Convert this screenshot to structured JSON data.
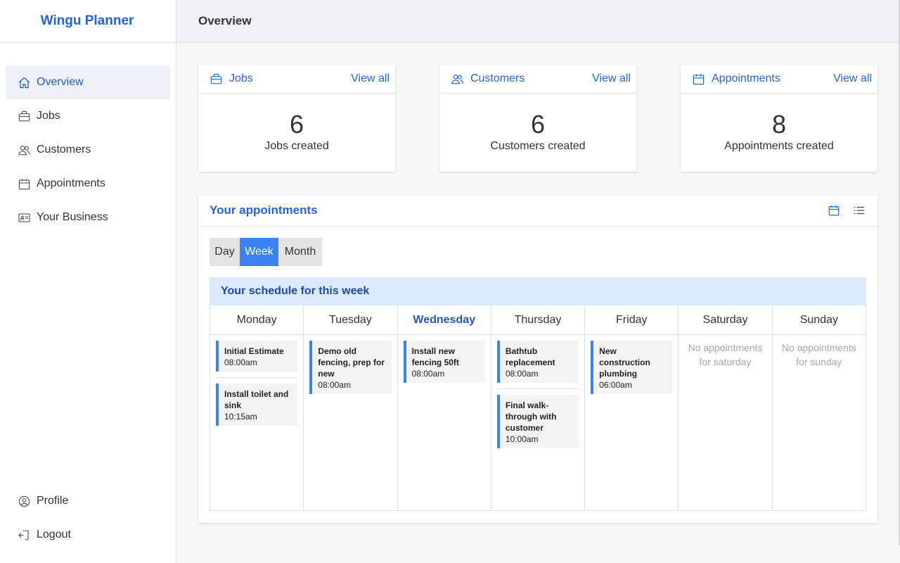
{
  "app": {
    "brand": "Wingu Planner",
    "page_title": "Overview"
  },
  "colors": {
    "accent": "#2563d9",
    "active_segment": "#3b82f6",
    "schedule_bar": "#dbeafe"
  },
  "sidebar": {
    "items": [
      {
        "label": "Overview",
        "icon": "home-icon",
        "active": true
      },
      {
        "label": "Jobs",
        "icon": "briefcase-icon"
      },
      {
        "label": "Customers",
        "icon": "users-icon"
      },
      {
        "label": "Appointments",
        "icon": "calendar-icon"
      },
      {
        "label": "Your Business",
        "icon": "id-card-icon"
      }
    ],
    "bottom": [
      {
        "label": "Profile",
        "icon": "user-circle-icon"
      },
      {
        "label": "Logout",
        "icon": "logout-icon"
      }
    ]
  },
  "stats": [
    {
      "title": "Jobs",
      "link": "View all",
      "count": "6",
      "label": "Jobs created",
      "icon": "briefcase-icon"
    },
    {
      "title": "Customers",
      "link": "View all",
      "count": "6",
      "label": "Customers created",
      "icon": "users-icon"
    },
    {
      "title": "Appointments",
      "link": "View all",
      "count": "8",
      "label": "Appointments created",
      "icon": "calendar-icon"
    }
  ],
  "appointments": {
    "title": "Your appointments",
    "views": [
      "Day",
      "Week",
      "Month"
    ],
    "selected_view": "Week",
    "schedule_title": "Your schedule for this week",
    "today": "Wednesday",
    "days": [
      {
        "name": "Monday",
        "items": [
          {
            "title": "Initial Estimate",
            "time": "08:00am"
          },
          {
            "title": "Install toilet and sink",
            "time": "10:15am"
          }
        ]
      },
      {
        "name": "Tuesday",
        "items": [
          {
            "title": "Demo old fencing, prep for new",
            "time": "08:00am"
          }
        ]
      },
      {
        "name": "Wednesday",
        "items": [
          {
            "title": "Install new fencing 50ft",
            "time": "08:00am"
          }
        ]
      },
      {
        "name": "Thursday",
        "items": [
          {
            "title": "Bathtub replacement",
            "time": "08:00am"
          },
          {
            "title": "Final walk-through with customer",
            "time": "10:00am"
          }
        ]
      },
      {
        "name": "Friday",
        "items": [
          {
            "title": "New construction plumbing",
            "time": "06:00am"
          }
        ]
      },
      {
        "name": "Saturday",
        "items": [],
        "empty": "No appointments for saturday"
      },
      {
        "name": "Sunday",
        "items": [],
        "empty": "No appointments for sunday"
      }
    ]
  }
}
